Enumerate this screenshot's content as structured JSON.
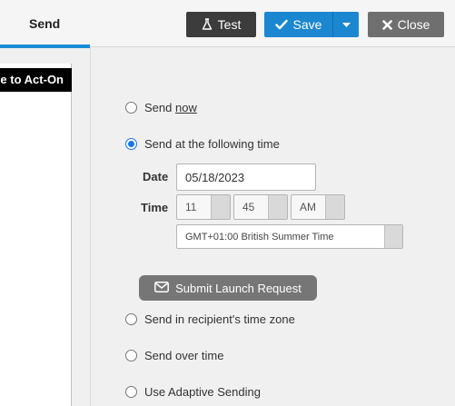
{
  "tabs": {
    "send_label": "Send"
  },
  "toolbar": {
    "test_label": "Test",
    "save_label": "Save",
    "close_label": "Close"
  },
  "sidebar": {
    "welcome_text": "e to Act-On"
  },
  "options": {
    "send_now_prefix": "Send ",
    "send_now_link": "now",
    "send_at_time": "Send at the following time",
    "send_recipient_tz": "Send in recipient's time zone",
    "send_over_time": "Send over time",
    "use_adaptive": "Use Adaptive Sending",
    "selected": "send_at_time"
  },
  "schedule": {
    "date_label": "Date",
    "date_value": "05/18/2023",
    "time_label": "Time",
    "hour": "11",
    "minute": "45",
    "ampm": "AM",
    "timezone": "GMT+01:00 British Summer Time"
  },
  "submit": {
    "label": "Submit Launch Request"
  },
  "colors": {
    "accent": "#1b87d1",
    "dark_button": "#3c3c3c",
    "close_button": "#6f6f6f",
    "submit_button": "#767676"
  }
}
